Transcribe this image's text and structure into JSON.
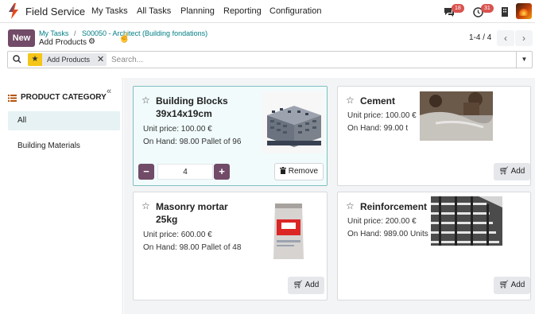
{
  "navbar": {
    "app_name": "Field Service",
    "menus": [
      "My Tasks",
      "All Tasks",
      "Planning",
      "Reporting",
      "Configuration"
    ],
    "chat_badge": "18",
    "activity_badge": "31"
  },
  "control_panel": {
    "new_label": "New",
    "breadcrumbs": [
      "My Tasks",
      "S00050 - Architect (Building fondations)"
    ],
    "breadcrumb_sep": "/",
    "title": "Add Products",
    "pager": "1-4 / 4"
  },
  "search": {
    "facet_label": "Add Products",
    "placeholder": "Search..."
  },
  "sidebar": {
    "header": "PRODUCT CATEGORY",
    "items": [
      {
        "label": "All",
        "active": true
      },
      {
        "label": "Building Materials",
        "active": false
      }
    ]
  },
  "products": [
    {
      "name": "Building Blocks",
      "name_line2": "39x14x19cm",
      "price": "Unit price: 100.00 €",
      "on_hand": "On Hand: 98.00 Pallet of 96",
      "quantity": "4",
      "remove_label": "Remove",
      "image": "concrete-blocks-pallet"
    },
    {
      "name": "Cement",
      "price": "Unit price: 100.00 €",
      "on_hand": "On Hand: 99.00 t",
      "add_label": "Add",
      "image": "cement-pour"
    },
    {
      "name": "Masonry mortar",
      "name_line2": "25kg",
      "price": "Unit price: 600.00 €",
      "on_hand": "On Hand: 98.00 Pallet of 48",
      "add_label": "Add",
      "image": "mortar-bag"
    },
    {
      "name": "Reinforcement",
      "price": "Unit price: 200.00 €",
      "on_hand": "On Hand: 989.00 Units",
      "add_label": "Add",
      "image": "building-frame"
    }
  ],
  "colors": {
    "brand": "#714b67",
    "link": "#017e84",
    "badge": "#d9534f",
    "facet_star": "#f5c518"
  }
}
